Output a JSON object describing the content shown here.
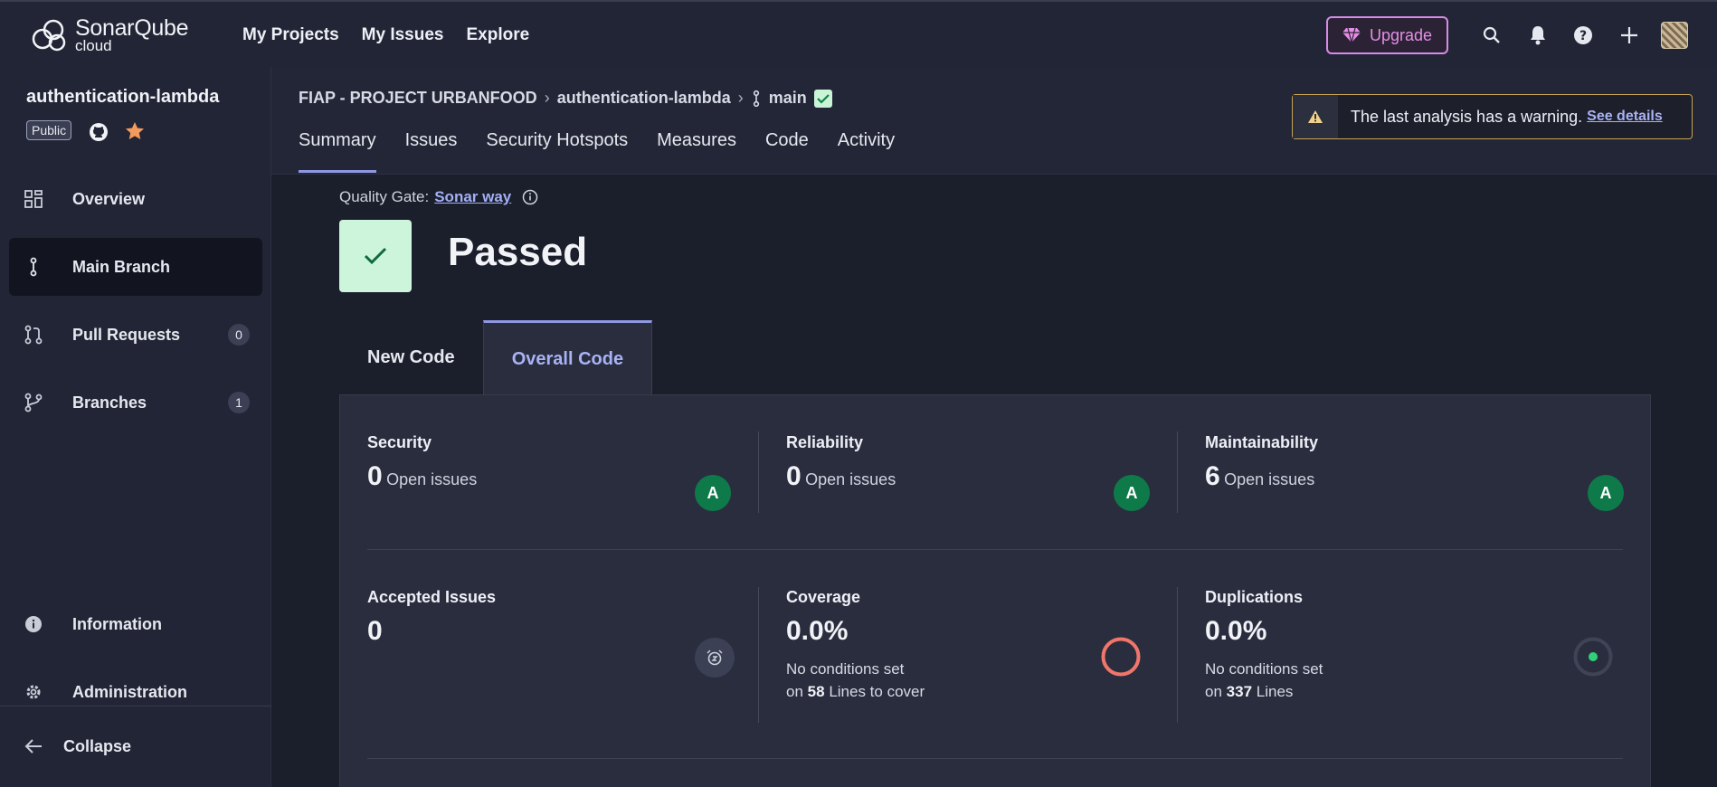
{
  "app": {
    "logo_title": "SonarQube",
    "logo_sub": "cloud"
  },
  "topnav": [
    "My Projects",
    "My Issues",
    "Explore"
  ],
  "upgrade_label": "Upgrade",
  "sidebar": {
    "project_name": "authentication-lambda",
    "visibility": "Public",
    "items": [
      {
        "label": "Overview",
        "icon": "grid-icon"
      },
      {
        "label": "Main Branch",
        "icon": "branch-icon"
      },
      {
        "label": "Pull Requests",
        "count": "0",
        "icon": "pull-request-icon"
      },
      {
        "label": "Branches",
        "count": "1",
        "icon": "branches-icon"
      },
      {
        "label": "Information",
        "icon": "info-icon"
      },
      {
        "label": "Administration",
        "icon": "gear-icon"
      }
    ],
    "collapse_label": "Collapse"
  },
  "breadcrumb": {
    "org": "FIAP - PROJECT URBANFOOD",
    "project": "authentication-lambda",
    "branch": "main"
  },
  "tabs": [
    "Summary",
    "Issues",
    "Security Hotspots",
    "Measures",
    "Code",
    "Activity"
  ],
  "warning": {
    "text": "The last analysis has a warning.",
    "link": "See details"
  },
  "quality_gate": {
    "label": "Quality Gate:",
    "name": "Sonar way",
    "status": "Passed"
  },
  "code_tabs": [
    "New Code",
    "Overall Code"
  ],
  "metrics": {
    "security": {
      "title": "Security",
      "value": "0",
      "unit": "Open issues",
      "grade": "A"
    },
    "reliability": {
      "title": "Reliability",
      "value": "0",
      "unit": "Open issues",
      "grade": "A"
    },
    "maintainability": {
      "title": "Maintainability",
      "value": "6",
      "unit": "Open issues",
      "grade": "A"
    },
    "accepted": {
      "title": "Accepted Issues",
      "value": "0"
    },
    "coverage": {
      "title": "Coverage",
      "value": "0.0%",
      "note": "No conditions set",
      "on": "on",
      "count": "58",
      "tail": "Lines to cover"
    },
    "duplications": {
      "title": "Duplications",
      "value": "0.0%",
      "note": "No conditions set",
      "on": "on",
      "count": "337",
      "tail": "Lines"
    }
  },
  "colors": {
    "accent": "#8e97e0",
    "grade": "#0e7a4a",
    "coverage_ring": "#f0766c",
    "dup_dot": "#2fd07a"
  }
}
